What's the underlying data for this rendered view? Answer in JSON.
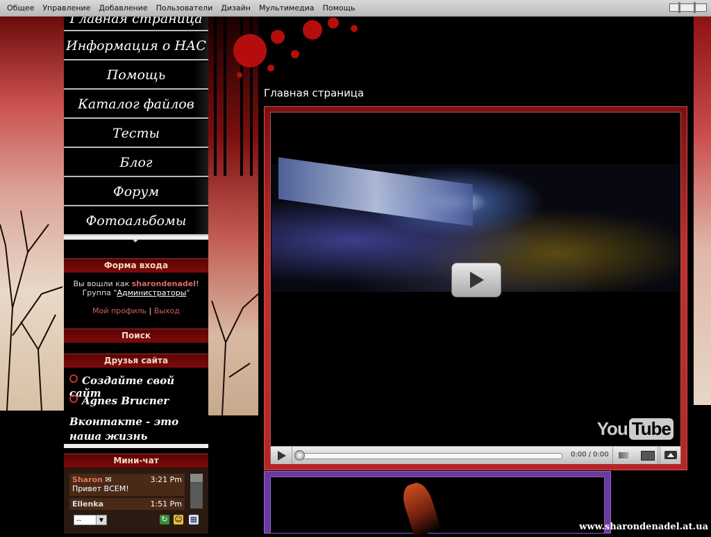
{
  "topbar": {
    "menu": [
      "Общее",
      "Управление",
      "Добавление",
      "Пользователи",
      "Дизайн",
      "Мультимедиа",
      "Помощь"
    ]
  },
  "nav": {
    "items": [
      "Главная страница",
      "Информация о НАС",
      "Помощь",
      "Каталог файлов",
      "Тесты",
      "Блог",
      "Форум",
      "Фотоальбомы"
    ]
  },
  "login": {
    "title": "Форма входа",
    "logged_as": "Вы вошли как ",
    "username": "sharondenadel",
    "exclaim": "!",
    "group_prefix": "Группа \"",
    "group": "Администраторы",
    "group_suffix": "\"",
    "profile_link": "Мой профиль",
    "separator": "|",
    "logout_link": "Выход"
  },
  "search": {
    "title": "Поиск"
  },
  "friends": {
    "title": "Друзья сайта",
    "items": [
      "Создайте свой сайт",
      "Agnes Brucner",
      "Вконтакте - это наша жизнь"
    ]
  },
  "chat": {
    "title": "Мини-чат",
    "messages": [
      {
        "nick": "Sharon",
        "time": "3:21 Pm",
        "text": "Привет ВСЕМ!"
      },
      {
        "nick": "Ellenka",
        "time": "1:51 Pm",
        "text": ""
      }
    ],
    "select_value": "--"
  },
  "main": {
    "title": "Главная страница",
    "player": {
      "logo_you": "You",
      "logo_tube": "Tube",
      "time": "0:00 / 0:00"
    }
  },
  "watermark": "www.sharondenadel.at.ua"
}
